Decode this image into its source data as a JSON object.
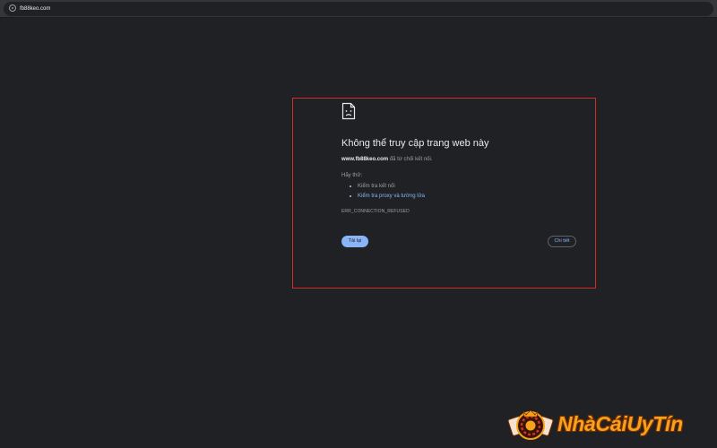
{
  "browser": {
    "url": "fb88keo.com",
    "site_info_icon": "site-info-icon"
  },
  "error_page": {
    "icon": "sad-page-icon",
    "title": "Không thể truy cập trang web này",
    "host": "www.fb88keo.com",
    "message": "đã từ chối kết nối.",
    "try_label": "Hãy thử:",
    "suggestions": [
      {
        "label": "Kiểm tra kết nối",
        "is_link": false
      },
      {
        "label": "Kiểm tra proxy và tường lửa",
        "is_link": true
      }
    ],
    "error_code": "ERR_CONNECTION_REFUSED",
    "reload_label": "Tải lại",
    "details_label": "Chi tiết"
  },
  "annotation": {
    "highlight_color": "#d42a2a"
  },
  "watermark": {
    "text": "NhàCáiUyTín",
    "icon": "casino-emblem-icon",
    "color": "#f6a21a"
  },
  "colors": {
    "background": "#202124",
    "link": "#8ab4f8",
    "text_primary": "#e8eaed",
    "text_secondary": "#9aa0a6"
  }
}
